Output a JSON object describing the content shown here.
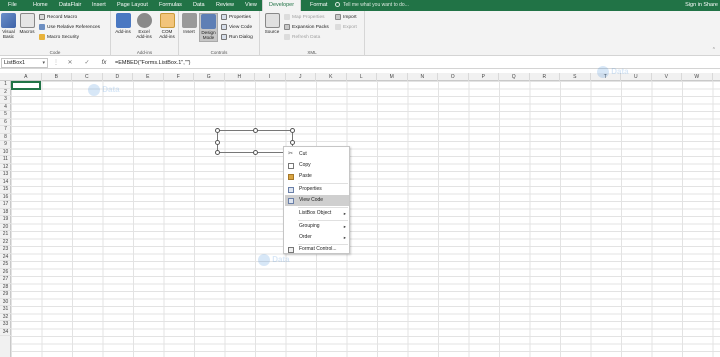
{
  "tabs": [
    "File",
    "Home",
    "DataFlair",
    "Insert",
    "Page Layout",
    "Formulas",
    "Data",
    "Review",
    "View",
    "Developer",
    "Format"
  ],
  "active_tab": "Developer",
  "tell_me": "Tell me what you want to do...",
  "sign_in": "Sign in",
  "share": "Share",
  "ribbon": {
    "code": {
      "label": "Code",
      "visual_basic": "Visual Basic",
      "macros": "Macros",
      "record_macro": "Record Macro",
      "relative_refs": "Use Relative References",
      "macro_security": "Macro Security"
    },
    "addins": {
      "label": "Add-ins",
      "addins": "Add-ins",
      "excel_addins": "Excel Add-ins",
      "com_addins": "COM Add-ins"
    },
    "controls": {
      "label": "Controls",
      "insert": "Insert",
      "design_mode": "Design Mode",
      "properties": "Properties",
      "view_code": "View Code",
      "run_dialog": "Run Dialog"
    },
    "xml": {
      "label": "XML",
      "source": "Source",
      "map_properties": "Map Properties",
      "expansion_packs": "Expansion Packs",
      "refresh_data": "Refresh Data",
      "import": "Import",
      "export": "Export"
    }
  },
  "formula_bar": {
    "name_box": "ListBox1",
    "formula": "=EMBED(\"Forms.ListBox.1\",\"\")",
    "cancel": "✕",
    "enter": "✓",
    "fx": "fx"
  },
  "columns": [
    "A",
    "B",
    "C",
    "D",
    "E",
    "F",
    "G",
    "H",
    "I",
    "J",
    "K",
    "L",
    "M",
    "N",
    "O",
    "P",
    "Q",
    "R",
    "S",
    "T",
    "U",
    "V",
    "W"
  ],
  "rows": [
    "1",
    "2",
    "3",
    "4",
    "5",
    "6",
    "7",
    "8",
    "9",
    "10",
    "11",
    "12",
    "13",
    "14",
    "15",
    "16",
    "17",
    "18",
    "19",
    "20",
    "21",
    "22",
    "23",
    "24",
    "25",
    "26",
    "27",
    "28",
    "29",
    "30",
    "31",
    "32",
    "33",
    "34"
  ],
  "watermark": [
    "Data",
    "Flair"
  ],
  "context_menu": [
    {
      "label": "Cut",
      "icon": "scissors-icon"
    },
    {
      "label": "Copy",
      "icon": "copy-icon"
    },
    {
      "label": "Paste",
      "icon": "paste-icon"
    },
    {
      "label": "Properties",
      "icon": "properties-icon"
    },
    {
      "label": "View Code",
      "icon": "view-code-icon"
    },
    {
      "label": "ListBox Object",
      "submenu": true
    },
    {
      "label": "Grouping",
      "submenu": true
    },
    {
      "label": "Order",
      "submenu": true
    },
    {
      "label": "Format Control...",
      "icon": "format-control-icon"
    }
  ],
  "colors": {
    "accent": "#217346",
    "highlight": "#cfcfcf"
  }
}
